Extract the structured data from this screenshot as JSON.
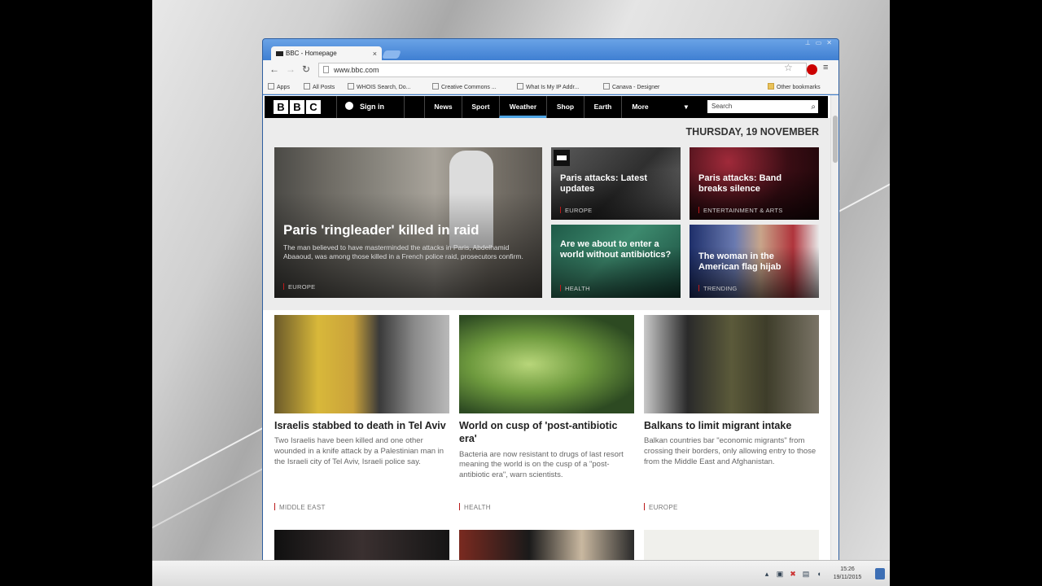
{
  "browser": {
    "tab_title": "BBC - Homepage",
    "tab_close": "×",
    "url": "www.bbc.com",
    "window_controls": [
      "⊥",
      "▭",
      "✕"
    ],
    "bookmarks": [
      {
        "label": "Apps",
        "icon": "apps-icon"
      },
      {
        "label": "All Posts",
        "icon": "page-icon"
      },
      {
        "label": "WHOIS Search, Do...",
        "icon": "page-icon"
      },
      {
        "label": "Creative Commons ...",
        "icon": "cc-icon"
      },
      {
        "label": "What Is My IP Addr...",
        "icon": "page-icon"
      },
      {
        "label": "Canava - Designer",
        "icon": "page-icon"
      }
    ],
    "other_bookmarks": "Other bookmarks"
  },
  "bbc": {
    "logo": [
      "B",
      "B",
      "C"
    ],
    "signin": "Sign in",
    "nav": [
      "News",
      "Sport",
      "Weather",
      "Shop",
      "Earth",
      "More"
    ],
    "more_caret": "▾",
    "search_placeholder": "Search",
    "date": "THURSDAY, 19 NOVEMBER"
  },
  "top_stories": {
    "lead": {
      "title": "Paris 'ringleader' killed in raid",
      "summary": "The man believed to have masterminded the attacks in Paris, Abdelhamid Abaaoud, was among those killed in a French police raid, prosecutors confirm.",
      "tag": "EUROPE"
    },
    "small": [
      {
        "title": "Paris attacks: Latest updates",
        "tag": "EUROPE"
      },
      {
        "title": "Paris attacks: Band breaks silence",
        "tag": "ENTERTAINMENT & ARTS"
      },
      {
        "title": "Are we about to enter a world without antibiotics?",
        "tag": "HEALTH"
      },
      {
        "title": "The woman in the American flag hijab",
        "tag": "TRENDING"
      }
    ]
  },
  "stories": [
    {
      "title": "Israelis stabbed to death in Tel Aviv",
      "summary": "Two Israelis have been killed and one other wounded in a knife attack by a Palestinian man in the Israeli city of Tel Aviv, Israeli police say.",
      "tag": "MIDDLE EAST"
    },
    {
      "title": "World on cusp of 'post-antibiotic era'",
      "summary": "Bacteria are now resistant to drugs of last resort meaning the world is on the cusp of a \"post-antibiotic era\", warn scientists.",
      "tag": "HEALTH"
    },
    {
      "title": "Balkans to limit migrant intake",
      "summary": "Balkan countries bar \"economic migrants\" from crossing their borders, only allowing entry to those from the Middle East and Afghanistan.",
      "tag": "EUROPE"
    }
  ],
  "taskbar": {
    "time": "15:26",
    "date": "19/11/2015"
  },
  "colors": {
    "bbc_black": "#000000",
    "chrome_blue": "#3e82d6",
    "tag_red": "#bb1919"
  }
}
